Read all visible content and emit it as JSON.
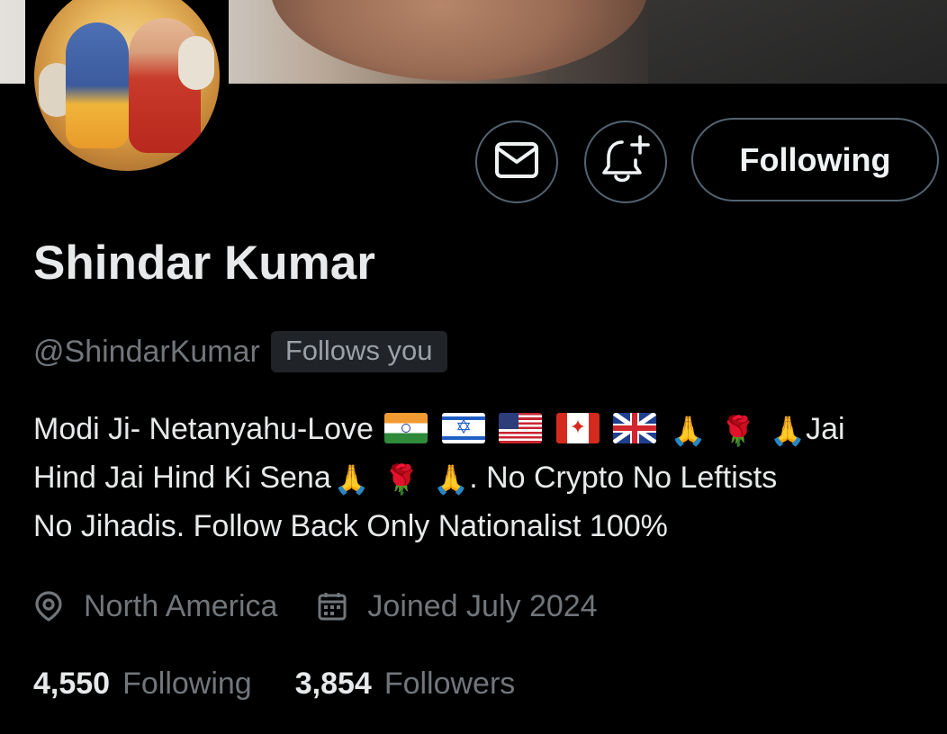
{
  "profile": {
    "name": "Shindar Kumar",
    "handle": "@ShindarKumar",
    "follows_you_badge": "Follows you"
  },
  "actions": {
    "message_icon": "envelope-icon",
    "notify_icon": "bell-plus-icon",
    "following_label": "Following"
  },
  "bio": {
    "line1_text": "Modi Ji- Netanyahu-Love",
    "line1_end": "Jai",
    "line2_start": "Hind Jai Hind Ki Sena",
    "line2_end": ". No Crypto No Leftists",
    "line3": "No Jihadis. Follow Back Only Nationalist 100%",
    "emoji": [
      "flag-india",
      "flag-israel",
      "flag-usa",
      "flag-canada",
      "flag-uk",
      "folded-hands",
      "rose",
      "folded-hands",
      "folded-hands",
      "rose",
      "folded-hands"
    ]
  },
  "meta": {
    "location": "North America",
    "location_icon": "location-pin-icon",
    "joined": "Joined July 2024",
    "joined_icon": "calendar-icon"
  },
  "stats": {
    "following_count": "4,550",
    "following_label": "Following",
    "followers_count": "3,854",
    "followers_label": "Followers"
  },
  "colors": {
    "background": "#000000",
    "primary_text": "#e7e9ea",
    "secondary_text": "#71767b",
    "border": "#536471",
    "badge_bg": "#202327"
  }
}
